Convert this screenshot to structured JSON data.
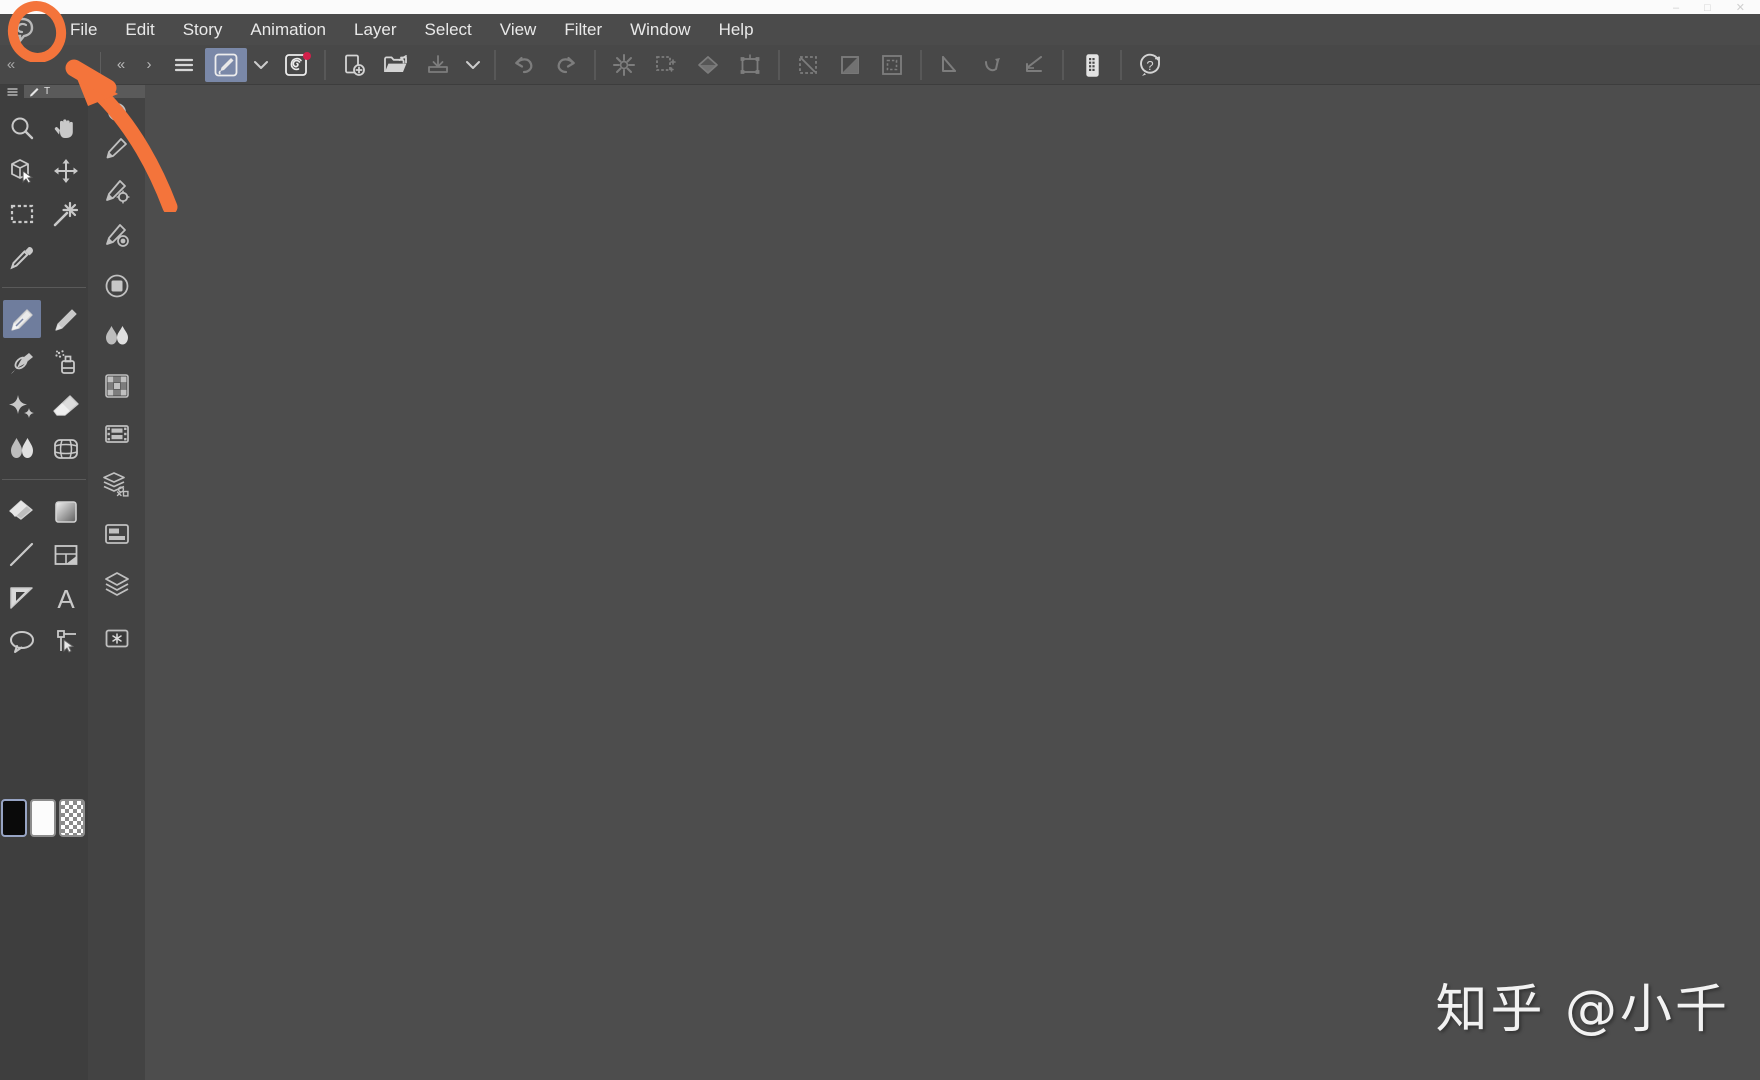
{
  "app": {
    "name": "Clip Studio Paint",
    "logo_icon": "clip-studio-logo-icon",
    "canvas_color": "#4d4d4d",
    "panel_color": "#3e3e3e",
    "accent_selected": "#6f7d9d",
    "badge_color": "#d1204a",
    "annotation_color": "#f4743b"
  },
  "window_controls": {
    "minimize": "–",
    "maximize": "□",
    "close": "✕"
  },
  "menubar": {
    "items": [
      {
        "label": "File",
        "name": "menu-file"
      },
      {
        "label": "Edit",
        "name": "menu-edit"
      },
      {
        "label": "Story",
        "name": "menu-story"
      },
      {
        "label": "Animation",
        "name": "menu-animation"
      },
      {
        "label": "Layer",
        "name": "menu-layer"
      },
      {
        "label": "Select",
        "name": "menu-select"
      },
      {
        "label": "View",
        "name": "menu-view"
      },
      {
        "label": "Filter",
        "name": "menu-filter"
      },
      {
        "label": "Window",
        "name": "menu-window"
      },
      {
        "label": "Help",
        "name": "menu-help"
      }
    ]
  },
  "command_bar": {
    "collapse_left_label": "«",
    "collapse_label": "«",
    "expand_label": "›",
    "buttons": [
      {
        "name": "command-bar-menu-button",
        "icon": "hamburger-icon",
        "label": "Command Bar Settings",
        "state": "normal"
      },
      {
        "name": "quick-access-button",
        "icon": "pen-square-icon",
        "label": "Quick Access",
        "state": "selected"
      },
      {
        "name": "quick-access-dropdown",
        "icon": "chevron-down-icon",
        "label": "Quick Access Options",
        "state": "normal"
      },
      {
        "name": "clip-studio-button",
        "icon": "clip-studio-spiral-icon",
        "label": "Clip Studio",
        "state": "normal",
        "badge": true
      },
      {
        "name": "new-file-button",
        "icon": "new-document-icon",
        "label": "New",
        "state": "normal"
      },
      {
        "name": "open-file-button",
        "icon": "open-folder-icon",
        "label": "Open",
        "state": "normal"
      },
      {
        "name": "save-file-button",
        "icon": "save-icon",
        "label": "Save",
        "state": "dimmed"
      },
      {
        "name": "save-dropdown",
        "icon": "chevron-down-icon",
        "label": "Save Options",
        "state": "normal"
      },
      {
        "name": "undo-button",
        "icon": "undo-arrow-icon",
        "label": "Undo",
        "state": "dimmed"
      },
      {
        "name": "redo-button",
        "icon": "redo-arrow-icon",
        "label": "Redo",
        "state": "dimmed"
      },
      {
        "name": "clear-button",
        "icon": "sparkle-burst-icon",
        "label": "Clear",
        "state": "dimmed"
      },
      {
        "name": "fill-selection-button",
        "icon": "fill-sparkle-icon",
        "label": "Fill",
        "state": "dimmed"
      },
      {
        "name": "fill-bucket-button",
        "icon": "fill-shape-icon",
        "label": "Fill Color",
        "state": "dimmed"
      },
      {
        "name": "scale-rotate-button",
        "icon": "transform-box-icon",
        "label": "Scale/Rotate",
        "state": "dimmed"
      },
      {
        "name": "deselect-button",
        "icon": "deselect-icon",
        "label": "Deselect",
        "state": "dimmed"
      },
      {
        "name": "invert-selection-button",
        "icon": "invert-selection-icon",
        "label": "Invert Selection",
        "state": "dimmed"
      },
      {
        "name": "expand-selection-button",
        "icon": "expand-selection-icon",
        "label": "Expand Selection",
        "state": "dimmed"
      },
      {
        "name": "ruler-snap-off-button",
        "icon": "snap-off-icon",
        "label": "Snap to Ruler Off",
        "state": "dimmed"
      },
      {
        "name": "snap-special-ruler-button",
        "icon": "snap-special-ruler-icon",
        "label": "Snap to Special Ruler",
        "state": "dimmed"
      },
      {
        "name": "snap-grid-button",
        "icon": "snap-grid-icon",
        "label": "Snap to Grid",
        "state": "dimmed"
      },
      {
        "name": "mobile-view-button",
        "icon": "tablet-device-icon",
        "label": "Mobile View",
        "state": "normal"
      },
      {
        "name": "help-button",
        "icon": "help-question-icon",
        "label": "Help",
        "state": "normal"
      }
    ]
  },
  "tool_property_header": {
    "menu_icon": "hamburger-icon",
    "tool_icon": "pen-icon",
    "title": "T"
  },
  "tool_palette": {
    "groups": [
      {
        "name": "navigation-group",
        "tools": [
          {
            "name": "tool-magnifier",
            "label": "Zoom",
            "icon": "magnifier-icon",
            "selected": false
          },
          {
            "name": "tool-hand",
            "label": "Move",
            "icon": "hand-icon",
            "selected": false
          },
          {
            "name": "tool-rotate-3d",
            "label": "Operation",
            "icon": "cube-pointer-icon",
            "selected": false
          },
          {
            "name": "tool-move-layer",
            "label": "Move Layer",
            "icon": "four-arrows-icon",
            "selected": false
          },
          {
            "name": "tool-marquee",
            "label": "Selection Area",
            "icon": "marquee-dashed-icon",
            "selected": false
          },
          {
            "name": "tool-auto-select",
            "label": "Auto Select",
            "icon": "magic-wand-icon",
            "selected": false
          },
          {
            "name": "tool-eyedropper",
            "label": "Eyedropper",
            "icon": "eyedropper-icon",
            "selected": false
          }
        ]
      },
      {
        "name": "drawing-group",
        "tools": [
          {
            "name": "tool-pen",
            "label": "Pen",
            "icon": "pen-nib-icon",
            "selected": true
          },
          {
            "name": "tool-pencil",
            "label": "Pencil",
            "icon": "pencil-nib-icon",
            "selected": false
          },
          {
            "name": "tool-brush",
            "label": "Brush",
            "icon": "brush-icon",
            "selected": false
          },
          {
            "name": "tool-airbrush",
            "label": "Airbrush",
            "icon": "airbrush-spray-icon",
            "selected": false
          },
          {
            "name": "tool-decoration",
            "label": "Decoration",
            "icon": "sparkles-icon",
            "selected": false
          },
          {
            "name": "tool-eraser",
            "label": "Eraser",
            "icon": "eraser-icon",
            "selected": false
          },
          {
            "name": "tool-blend",
            "label": "Blend",
            "icon": "blend-drops-icon",
            "selected": false
          },
          {
            "name": "tool-correct-line",
            "label": "Correct Line",
            "icon": "correct-line-grid-icon",
            "selected": false
          }
        ]
      },
      {
        "name": "shape-group",
        "tools": [
          {
            "name": "tool-fill",
            "label": "Fill",
            "icon": "paint-bucket-icon",
            "selected": false
          },
          {
            "name": "tool-gradient",
            "label": "Gradient",
            "icon": "gradient-square-icon",
            "selected": false
          },
          {
            "name": "tool-figure",
            "label": "Figure",
            "icon": "diagonal-line-icon",
            "selected": false
          },
          {
            "name": "tool-frame-border",
            "label": "Frame Border",
            "icon": "frame-layout-icon",
            "selected": false
          },
          {
            "name": "tool-ruler",
            "label": "Ruler",
            "icon": "set-square-icon",
            "selected": false
          },
          {
            "name": "tool-text",
            "label": "Text",
            "icon": "letter-a-icon",
            "selected": false
          },
          {
            "name": "tool-balloon",
            "label": "Balloon",
            "icon": "speech-balloon-icon",
            "selected": false
          },
          {
            "name": "tool-3d-object",
            "label": "3D Object",
            "icon": "object-pointer-icon",
            "selected": false
          }
        ]
      }
    ],
    "color_swatches": [
      {
        "name": "swatch-main-color",
        "label": "Main color",
        "color": "#0a0a0a",
        "selected": true
      },
      {
        "name": "swatch-sub-color",
        "label": "Sub color",
        "color": "#fcfcfc",
        "selected": false
      },
      {
        "name": "swatch-transparent",
        "label": "Transparent",
        "color": "transparent",
        "selected": false
      }
    ]
  },
  "sub_column": {
    "items": [
      {
        "name": "subtool-pen-circle",
        "label": "Pen Sub Tool",
        "icon": "pen-circle-icon"
      },
      {
        "name": "subtool-pen-plain",
        "label": "Pen",
        "icon": "pen-small-icon"
      },
      {
        "name": "subtool-pen-settings",
        "label": "Sub Tool Detail",
        "icon": "pen-gear-icon"
      },
      {
        "name": "subtool-brush-size",
        "label": "Brush Size",
        "icon": "pen-target-icon"
      },
      {
        "name": "subtool-layer-property",
        "label": "Layer Property",
        "icon": "rounded-square-icon"
      },
      {
        "name": "subtool-color-mixing",
        "label": "Color Mixing",
        "icon": "blend-drops-icon"
      },
      {
        "name": "subtool-material",
        "label": "Material",
        "icon": "checker-palette-icon"
      },
      {
        "name": "subtool-timeline",
        "label": "Timeline",
        "icon": "film-strip-icon"
      },
      {
        "name": "subtool-animation-cels",
        "label": "Animation Cels",
        "icon": "stacked-layers-gear-icon"
      },
      {
        "name": "subtool-layer-list",
        "label": "Layer List",
        "icon": "layer-panel-icon"
      },
      {
        "name": "subtool-layers",
        "label": "Layers",
        "icon": "layers-stack-icon"
      },
      {
        "name": "subtool-quick-mask",
        "label": "Quick Mask",
        "icon": "snowflake-box-icon"
      }
    ]
  },
  "annotations": [
    {
      "name": "annotation-circle-logo",
      "shape": "ellipse",
      "target": "clip-studio-logo-icon",
      "color": "#f4743b"
    },
    {
      "name": "annotation-arrow",
      "shape": "arrow",
      "target": "tool-property-palette",
      "color": "#f4743b"
    }
  ],
  "watermark": {
    "text": "知乎 @小千"
  }
}
